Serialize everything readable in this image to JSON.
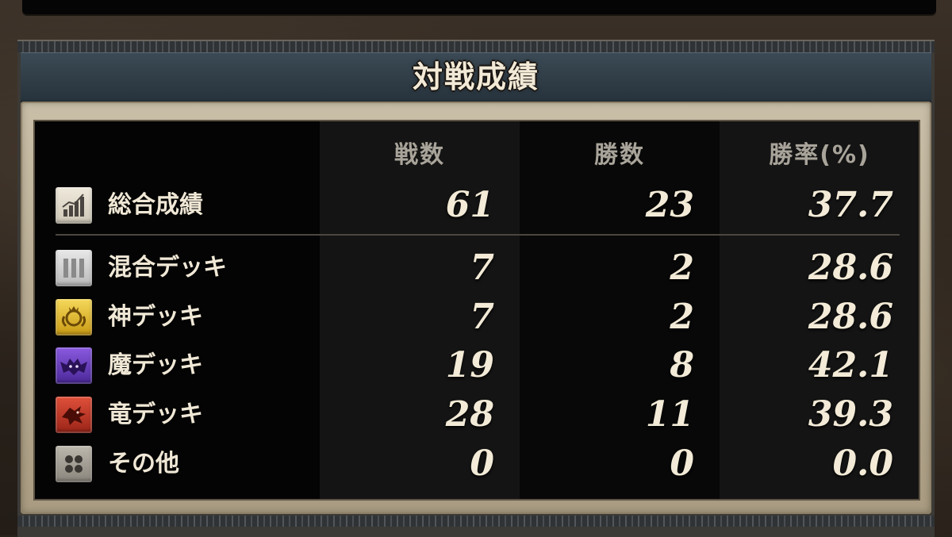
{
  "title": "対戦成績",
  "headers": [
    "戦数",
    "勝数",
    "勝率(%)"
  ],
  "rows": [
    {
      "icon": "chart-icon",
      "label": "総合成績",
      "battles": "61",
      "wins": "23",
      "rate": "37.7",
      "color": "#d9d2c2"
    },
    {
      "icon": "mixed-deck-icon",
      "label": "混合デッキ",
      "battles": "7",
      "wins": "2",
      "rate": "28.6",
      "color": "#c8c8c8"
    },
    {
      "icon": "god-deck-icon",
      "label": "神デッキ",
      "battles": "7",
      "wins": "2",
      "rate": "28.6",
      "color": "#e0b82a"
    },
    {
      "icon": "demon-deck-icon",
      "label": "魔デッキ",
      "battles": "19",
      "wins": "8",
      "rate": "42.1",
      "color": "#6a3cc0"
    },
    {
      "icon": "dragon-deck-icon",
      "label": "竜デッキ",
      "battles": "28",
      "wins": "11",
      "rate": "39.3",
      "color": "#c23a2a"
    },
    {
      "icon": "other-icon",
      "label": "その他",
      "battles": "0",
      "wins": "0",
      "rate": "0.0",
      "color": "#a8a49c"
    }
  ]
}
